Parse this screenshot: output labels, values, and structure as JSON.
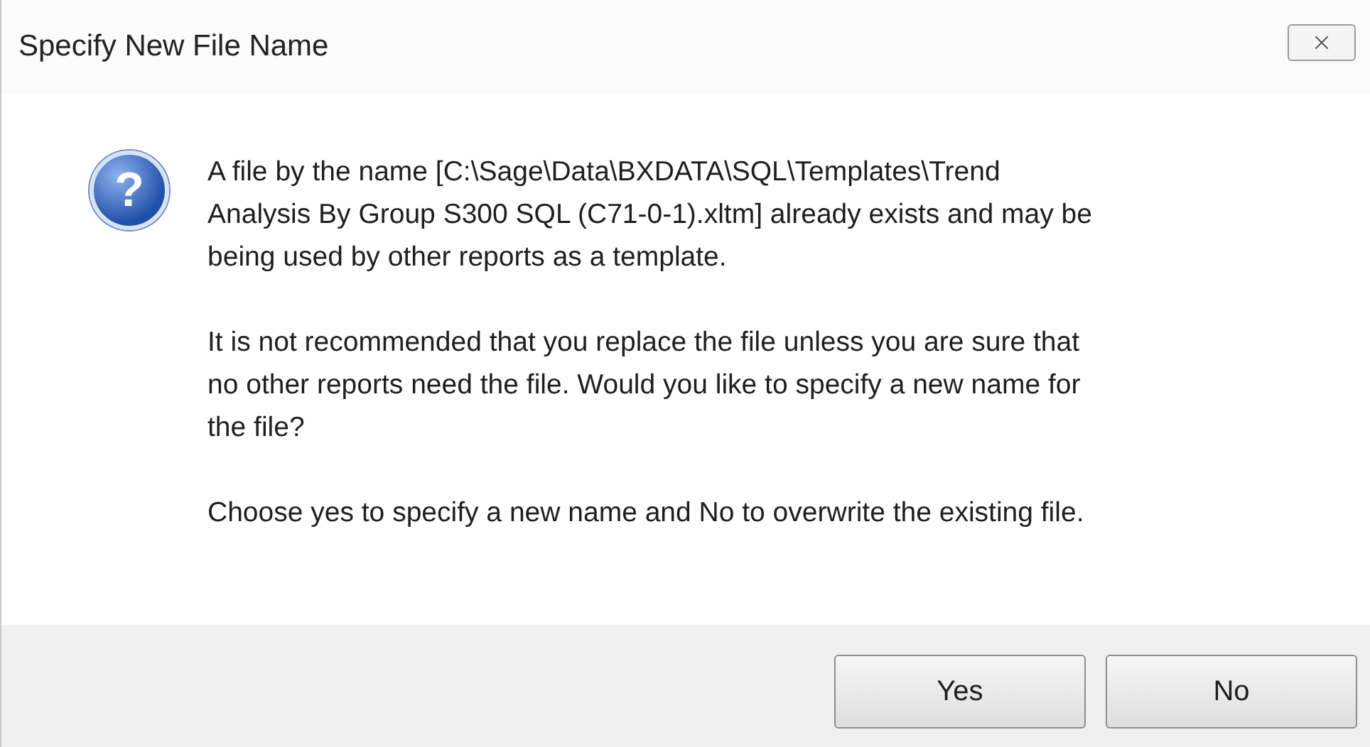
{
  "window": {
    "title": "Specify New File Name"
  },
  "icon": {
    "symbol": "?"
  },
  "message": [
    {
      "lines": [
        "A file by the name [C:\\Sage\\Data\\BXDATA\\SQL\\Templates\\Trend",
        "Analysis By Group S300 SQL (C71-0-1).xltm] already exists and may be",
        "being used by other reports as a template."
      ]
    },
    {
      "lines": [
        "It is not recommended that you replace the file unless you are sure that",
        "no other reports need the file. Would you like to specify a new name for",
        "the file?"
      ]
    },
    {
      "lines": [
        "Choose yes to specify a new name and No to overwrite the existing file."
      ]
    }
  ],
  "buttons": [
    "Yes",
    "No"
  ]
}
